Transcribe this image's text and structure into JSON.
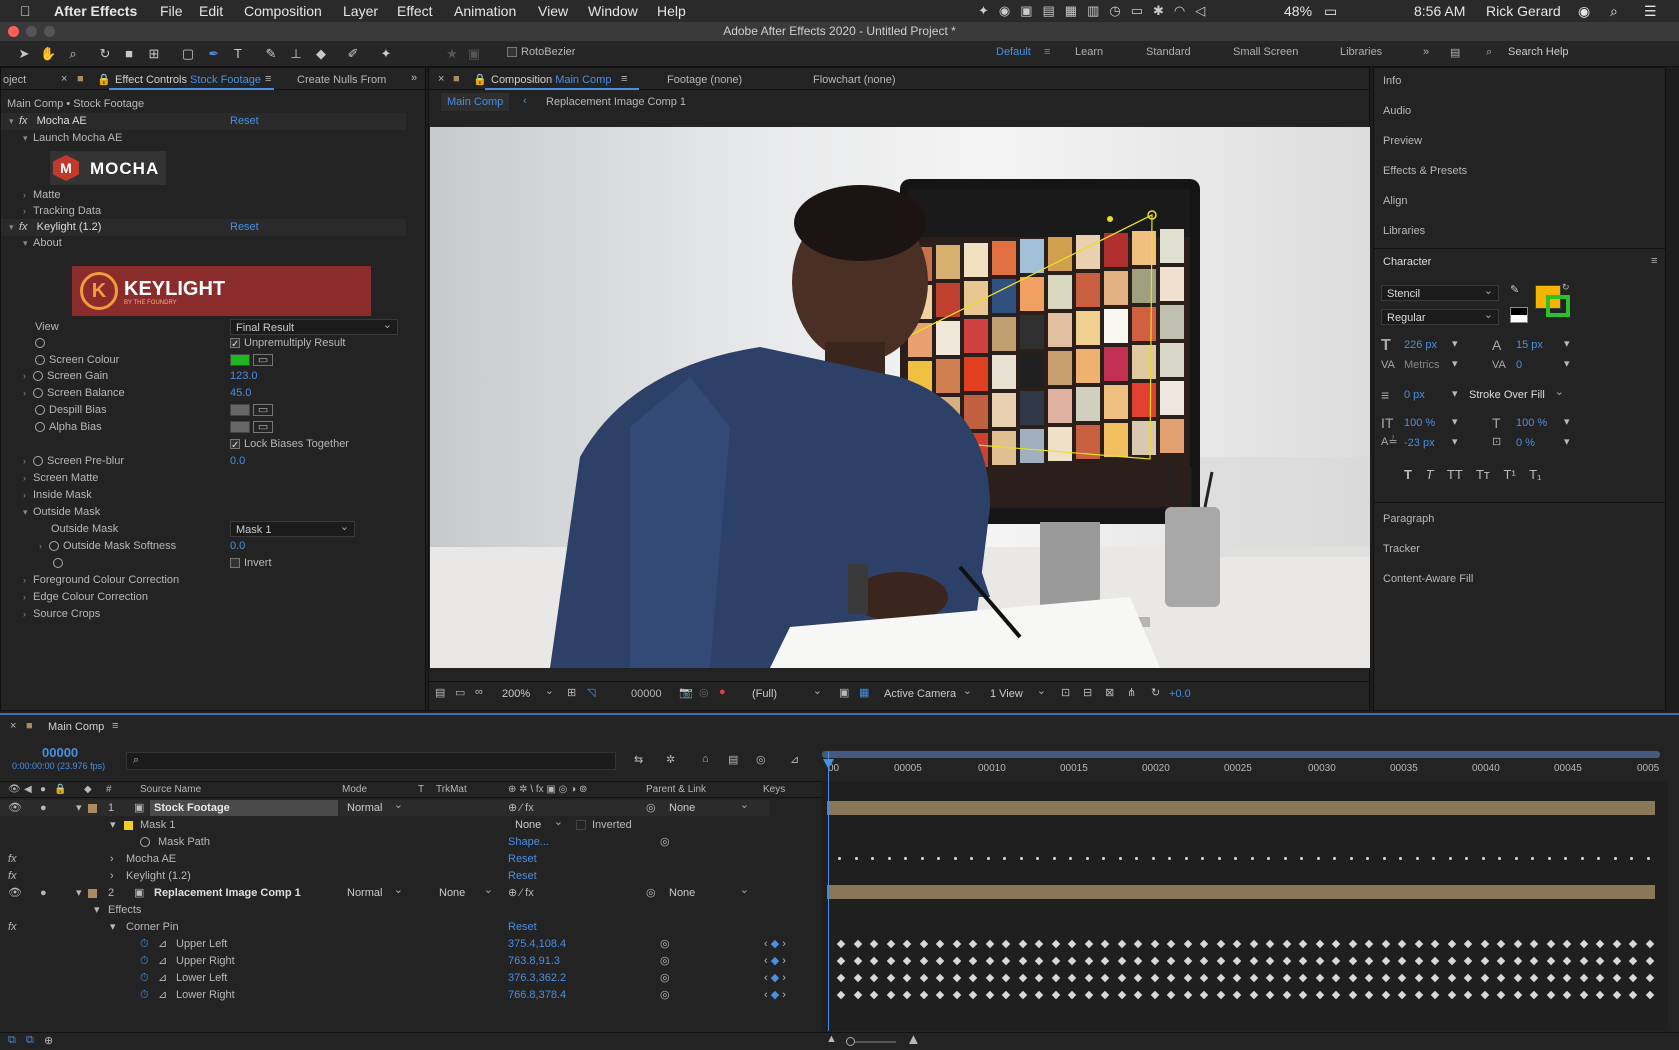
{
  "menubar": {
    "app": "After Effects",
    "items": [
      "File",
      "Edit",
      "Composition",
      "Layer",
      "Effect",
      "Animation",
      "View",
      "Window",
      "Help"
    ],
    "battery": "48%",
    "time": "8:56 AM",
    "user": "Rick Gerard"
  },
  "window_title": "Adobe After Effects 2020 - Untitled Project *",
  "toolbar": {
    "rotobezier": "RotoBezier",
    "workspaces": [
      "Default",
      "Learn",
      "Standard",
      "Small Screen",
      "Libraries"
    ],
    "active_workspace": "Default",
    "search_placeholder": "Search Help"
  },
  "left_panel": {
    "tabs": {
      "project": "oject",
      "effect_controls_prefix": "Effect Controls",
      "effect_controls_layer": "Stock Footage",
      "create_nulls": "Create Nulls From"
    },
    "breadcrumb": "Main Comp • Stock Footage",
    "mocha": {
      "name": "Mocha AE",
      "reset": "Reset",
      "launch": "Launch Mocha AE",
      "logo": "MOCHA",
      "matte": "Matte",
      "tracking": "Tracking Data"
    },
    "keylight": {
      "name": "Keylight (1.2)",
      "reset": "Reset",
      "about": "About",
      "logo": "KEYLIGHT",
      "logo_sub": "BY THE FOUNDRY",
      "view_label": "View",
      "view_value": "Final Result",
      "unpremultiply": "Unpremultiply Result",
      "screen_colour": "Screen Colour",
      "screen_gain": "Screen Gain",
      "screen_gain_value": "123.0",
      "screen_balance": "Screen Balance",
      "screen_balance_value": "45.0",
      "despill_bias": "Despill Bias",
      "alpha_bias": "Alpha Bias",
      "lock_biases": "Lock Biases Together",
      "screen_preblur": "Screen Pre-blur",
      "screen_preblur_value": "0.0",
      "screen_matte": "Screen Matte",
      "inside_mask": "Inside Mask",
      "outside_mask_group": "Outside Mask",
      "outside_mask_label": "Outside Mask",
      "outside_mask_value": "Mask 1",
      "outside_mask_softness": "Outside Mask Softness",
      "outside_mask_softness_value": "0.0",
      "invert": "Invert",
      "fg_colour": "Foreground Colour Correction",
      "edge_colour": "Edge Colour Correction",
      "source_crops": "Source Crops"
    }
  },
  "viewer": {
    "tabs": {
      "composition_prefix": "Composition",
      "composition_name": "Main Comp",
      "footage": "Footage (none)",
      "flowchart": "Flowchart (none)"
    },
    "breadcrumbs": [
      "Main Comp",
      "Replacement Image Comp 1"
    ],
    "bottom": {
      "zoom": "200%",
      "timecode": "00000",
      "resolution": "(Full)",
      "camera": "Active Camera",
      "views": "1 View",
      "exposure": "+0.0"
    }
  },
  "right_panel": {
    "items_top": [
      "Info",
      "Audio",
      "Preview",
      "Effects & Presets",
      "Align",
      "Libraries"
    ],
    "character": {
      "title": "Character",
      "font": "Stencil",
      "style": "Regular",
      "size": "226 px",
      "leading": "15 px",
      "kerning": "Metrics",
      "tracking": "0",
      "stroke_width": "0 px",
      "stroke_type": "Stroke Over Fill",
      "vscale": "100 %",
      "hscale": "100 %",
      "baseline": "-23 px",
      "tsume": "0 %",
      "fill_color": "#f5b400",
      "stroke_color": "#29c22a"
    },
    "items_bottom": [
      "Paragraph",
      "Tracker",
      "Content-Aware Fill"
    ]
  },
  "timeline": {
    "tab": "Main Comp",
    "timecode": "00000",
    "timecode_sub": "0:00:00:00 (23.976 fps)",
    "headers": {
      "source": "Source Name",
      "mode": "Mode",
      "t": "T",
      "trkmat": "TrkMat",
      "parent": "Parent & Link",
      "keys": "Keys"
    },
    "ruler": [
      "00005",
      "00010",
      "00015",
      "00020",
      "00025",
      "00030",
      "00035",
      "00040",
      "00045",
      "0005"
    ],
    "ruler_start": "00",
    "layers": [
      {
        "num": "1",
        "name": "Stock Footage",
        "mode": "Normal",
        "parent": "None"
      },
      {
        "num": "2",
        "name": "Replacement Image Comp 1",
        "mode": "Normal",
        "trkmat": "None",
        "parent": "None"
      }
    ],
    "mask": {
      "name": "Mask 1",
      "mode": "None",
      "inverted": "Inverted",
      "path": "Mask Path",
      "path_value": "Shape..."
    },
    "fx1": {
      "name": "Mocha AE",
      "reset": "Reset"
    },
    "fx2": {
      "name": "Keylight (1.2)",
      "reset": "Reset"
    },
    "effects": "Effects",
    "corner_pin": {
      "name": "Corner Pin",
      "reset": "Reset"
    },
    "props": [
      {
        "name": "Upper Left",
        "value": "375.4,108.4"
      },
      {
        "name": "Upper Right",
        "value": "763.8,91.3"
      },
      {
        "name": "Lower Left",
        "value": "376.3,362.2"
      },
      {
        "name": "Lower Right",
        "value": "766.8,378.4"
      }
    ]
  }
}
